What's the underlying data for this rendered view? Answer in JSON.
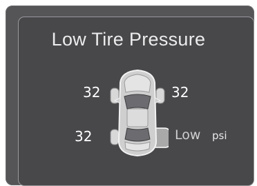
{
  "display": {
    "title": "Low Tire Pressure",
    "tires": {
      "front_left": "32",
      "front_right": "32",
      "rear_left": "32",
      "rear_right": "Low"
    },
    "unit": "psi",
    "car_icon": "car-top-view-icon",
    "warning_tire": "rear_right"
  }
}
